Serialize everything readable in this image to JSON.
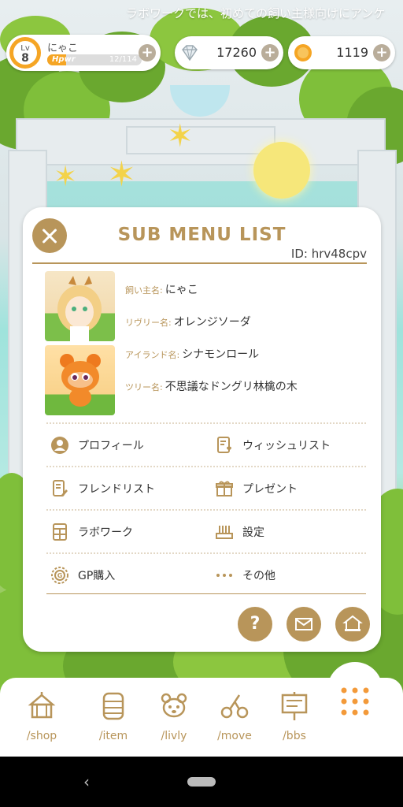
{
  "ticker": {
    "text": "ラボワークでは、初めての飼い主様向けにアンケ"
  },
  "status": {
    "level_prefix": "Lv",
    "level": "8",
    "player_name": "にゃこ",
    "hp_label": "Hpwr",
    "hp_value": "12/114",
    "hp_fraction": 0.105,
    "diamonds": "17260",
    "coins": "1119"
  },
  "modal": {
    "title": "SUB MENU LIST",
    "id_text": "ID: hrv48cpv",
    "info": [
      {
        "label": "飼い主名:",
        "value": "にゃこ"
      },
      {
        "label": "リヴリー名:",
        "value": "オレンジソーダ"
      },
      {
        "label": "アイランド名:",
        "value": "シナモンロール"
      },
      {
        "label": "ツリー名:",
        "value": "不思議なドングリ林檎の木"
      }
    ],
    "menu": [
      {
        "label": "プロフィール",
        "icon": "profile-icon"
      },
      {
        "label": "ウィッシュリスト",
        "icon": "wishlist-icon"
      },
      {
        "label": "フレンドリスト",
        "icon": "friend-list-icon"
      },
      {
        "label": "プレゼント",
        "icon": "present-icon"
      },
      {
        "label": "ラボワーク",
        "icon": "labwork-icon"
      },
      {
        "label": "設定",
        "icon": "settings-icon"
      },
      {
        "label": "GP購入",
        "icon": "gp-coin-icon"
      },
      {
        "label": "その他",
        "icon": "more-dots-icon"
      }
    ],
    "help_label": "?"
  },
  "nav": [
    {
      "label": "/shop",
      "icon": "shop-tent-icon"
    },
    {
      "label": "/item",
      "icon": "item-chest-icon"
    },
    {
      "label": "/livly",
      "icon": "livly-face-icon"
    },
    {
      "label": "/move",
      "icon": "move-scissors-icon"
    },
    {
      "label": "/bbs",
      "icon": "bbs-board-icon"
    }
  ],
  "colors": {
    "accent": "#b8955a",
    "level_ring": "#f5a524",
    "menu_dots": "#f39a3a"
  }
}
